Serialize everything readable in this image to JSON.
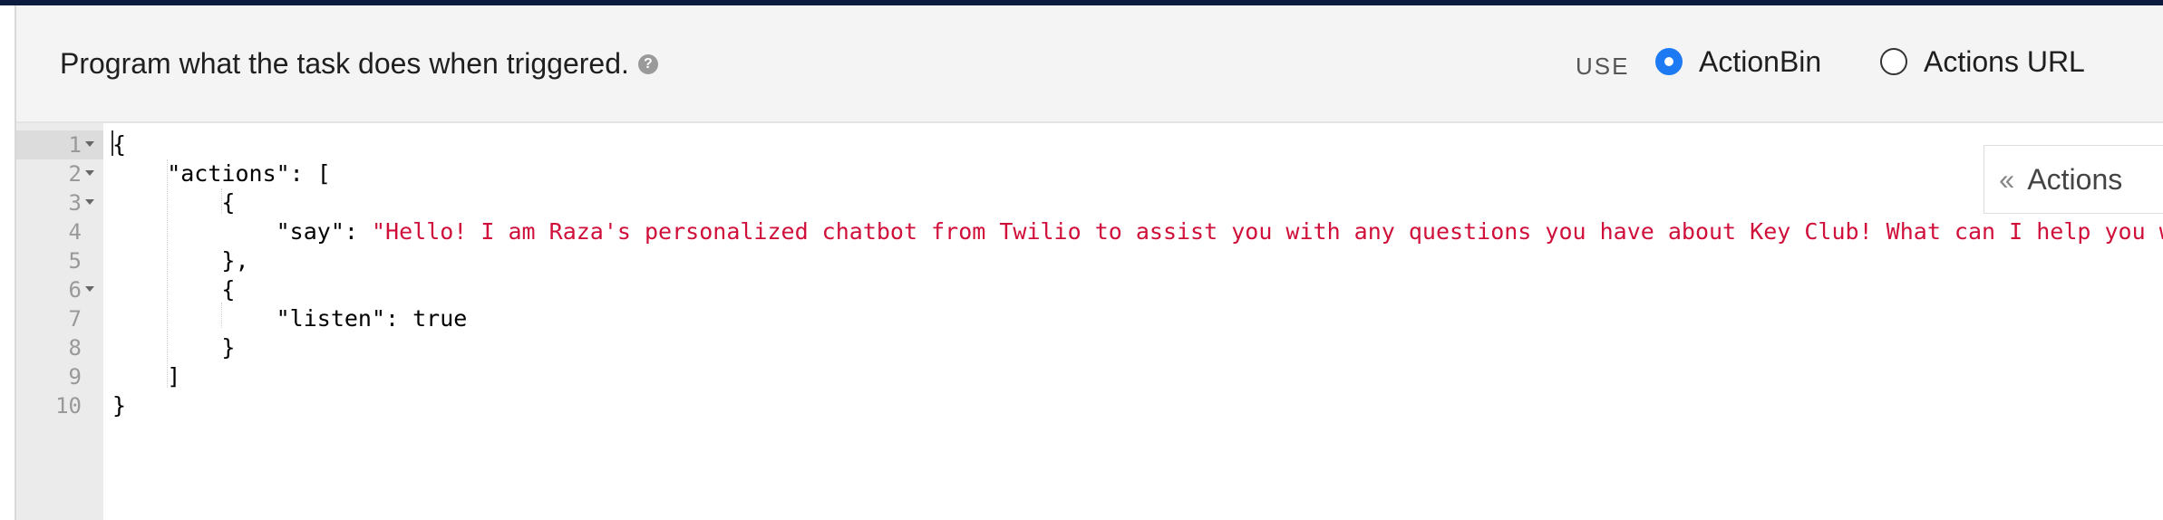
{
  "header": {
    "title": "Program what the task does when triggered.",
    "help_icon": "?",
    "use_label": "USE",
    "options": [
      {
        "label": "ActionBin",
        "selected": true
      },
      {
        "label": "Actions URL",
        "selected": false
      }
    ]
  },
  "editor": {
    "line_numbers": [
      "1",
      "2",
      "3",
      "4",
      "5",
      "6",
      "7",
      "8",
      "9",
      "10"
    ],
    "lines": [
      {
        "parts": [
          {
            "t": "{",
            "c": "p"
          }
        ]
      },
      {
        "parts": [
          {
            "t": "    \"actions\": [",
            "c": "p"
          }
        ]
      },
      {
        "parts": [
          {
            "t": "        {",
            "c": "p"
          }
        ]
      },
      {
        "parts": [
          {
            "t": "            \"say\": ",
            "c": "p"
          },
          {
            "t": "\"Hello! I am Raza's personalized chatbot from Twilio to assist you with any questions you have about Key Club! What can I help you with?\"",
            "c": "str"
          }
        ]
      },
      {
        "parts": [
          {
            "t": "        },",
            "c": "p"
          }
        ]
      },
      {
        "parts": [
          {
            "t": "        {",
            "c": "p"
          }
        ]
      },
      {
        "parts": [
          {
            "t": "            \"listen\": true",
            "c": "p"
          }
        ]
      },
      {
        "parts": [
          {
            "t": "        }",
            "c": "p"
          }
        ]
      },
      {
        "parts": [
          {
            "t": "    ]",
            "c": "p"
          }
        ]
      },
      {
        "parts": [
          {
            "t": "}",
            "c": "p"
          }
        ]
      }
    ],
    "foldable": [
      1,
      2,
      3,
      6
    ]
  },
  "side_tab": {
    "label": "Actions",
    "icon": "chevron-double-left-icon"
  },
  "colors": {
    "string": "#d0103a",
    "accent": "#1d7af3"
  }
}
